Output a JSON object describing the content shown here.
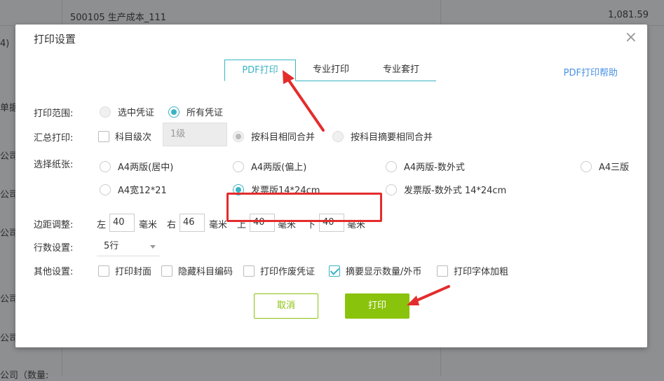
{
  "background": {
    "row1_text": "500105 生产成本_111",
    "row1_amount": "1,081.59",
    "left_snippets": [
      "4)",
      "单据",
      "公司",
      "公司",
      "公司",
      "公司",
      "公司",
      "公司（数量:"
    ]
  },
  "dialog": {
    "title": "打印设置",
    "close_glyph": "×",
    "tabs": [
      {
        "label": "PDF打印",
        "active": true
      },
      {
        "label": "专业打印",
        "active": false
      },
      {
        "label": "专业套打",
        "active": false
      }
    ],
    "help_link": "PDF打印帮助",
    "print_range": {
      "label": "打印范围:",
      "options": [
        {
          "label": "选中凭证",
          "selected": false
        },
        {
          "label": "所有凭证",
          "selected": true
        }
      ]
    },
    "summary_print": {
      "label": "汇总打印:",
      "checkbox_label": "科目级次",
      "checked": false,
      "level_value": "1级",
      "options": [
        {
          "label": "按科目相同合并",
          "selected": true
        },
        {
          "label": "按科目摘要相同合并",
          "selected": false
        }
      ]
    },
    "paper": {
      "label": "选择纸张:",
      "options": [
        {
          "label": "A4两版(居中)",
          "selected": false
        },
        {
          "label": "A4两版(偏上)",
          "selected": false
        },
        {
          "label": "A4两版-数外式",
          "selected": false
        },
        {
          "label": "A4三版",
          "selected": false
        },
        {
          "label": "A4宽12*21",
          "selected": false
        },
        {
          "label": "发票版14*24cm",
          "selected": true
        },
        {
          "label": "发票版-数外式 14*24cm",
          "selected": false
        }
      ]
    },
    "margins": {
      "label": "边距调整:",
      "unit": "毫米",
      "left_label": "左",
      "left_value": "40",
      "right_label": "右",
      "right_value": "46",
      "top_label": "上",
      "top_value": "40",
      "bottom_label": "下",
      "bottom_value": "40"
    },
    "rows": {
      "label": "行数设置:",
      "value": "5行"
    },
    "other": {
      "label": "其他设置:",
      "options": [
        {
          "label": "打印封面",
          "checked": false
        },
        {
          "label": "隐藏科目编码",
          "checked": false
        },
        {
          "label": "打印作废凭证",
          "checked": false
        },
        {
          "label": "摘要显示数量/外币",
          "checked": true
        },
        {
          "label": "打印字体加粗",
          "checked": false
        }
      ]
    },
    "cancel_label": "取消",
    "print_label": "打印"
  },
  "colors": {
    "accent": "#3bb3c3",
    "button_green": "#8ac30b",
    "annotation_red": "#e42c2c",
    "help_blue": "#4a90e2"
  }
}
